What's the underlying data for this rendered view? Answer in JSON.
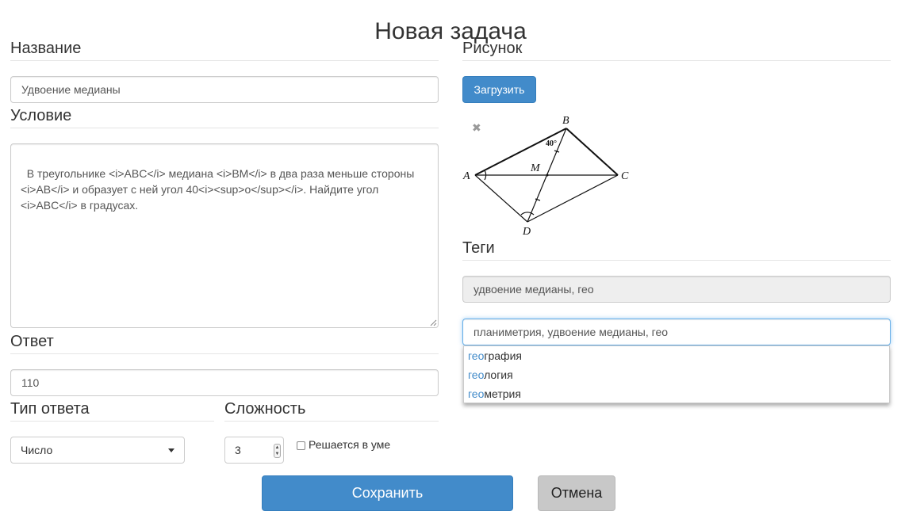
{
  "page": {
    "title": "Новая задача"
  },
  "name_section": {
    "heading": "Название",
    "value": "Удвоение медианы"
  },
  "condition_section": {
    "heading": "Условие",
    "text": "В треугольнике <i>ABC</i> медиана <i>BM</i> в два раза меньше стороны\n<i>AB</i> и образует с ней угол 40<i><sup>o</sup></i>. Найдите угол\n<i>ABC</i> в градусах."
  },
  "answer_section": {
    "heading": "Ответ",
    "value": "110"
  },
  "answer_type": {
    "heading": "Тип ответа",
    "selected": "Число"
  },
  "difficulty": {
    "heading": "Сложность",
    "value": "3",
    "mental_label": "Решается в уме",
    "mental_checked": false
  },
  "picture_section": {
    "heading": "Рисунок",
    "upload_label": "Загрузить",
    "remove_icon": "close-icon",
    "labels": {
      "a": "A",
      "b": "B",
      "c": "C",
      "d": "D",
      "m": "M",
      "angle": "40°"
    }
  },
  "tags_section": {
    "heading": "Теги",
    "current_tags": "удвоение медианы, гео",
    "input_value": "планиметрия, удвоение медианы, гео",
    "suggestions": [
      {
        "match": "гео",
        "rest": "графия"
      },
      {
        "match": "гео",
        "rest": "логия"
      },
      {
        "match": "гео",
        "rest": "метрия"
      }
    ]
  },
  "actions": {
    "save_label": "Сохранить",
    "cancel_label": "Отмена"
  },
  "colors": {
    "primary": "#428bca",
    "cancel": "#c8c8c8",
    "focus": "#66afe9",
    "highlight": "#428bca"
  }
}
